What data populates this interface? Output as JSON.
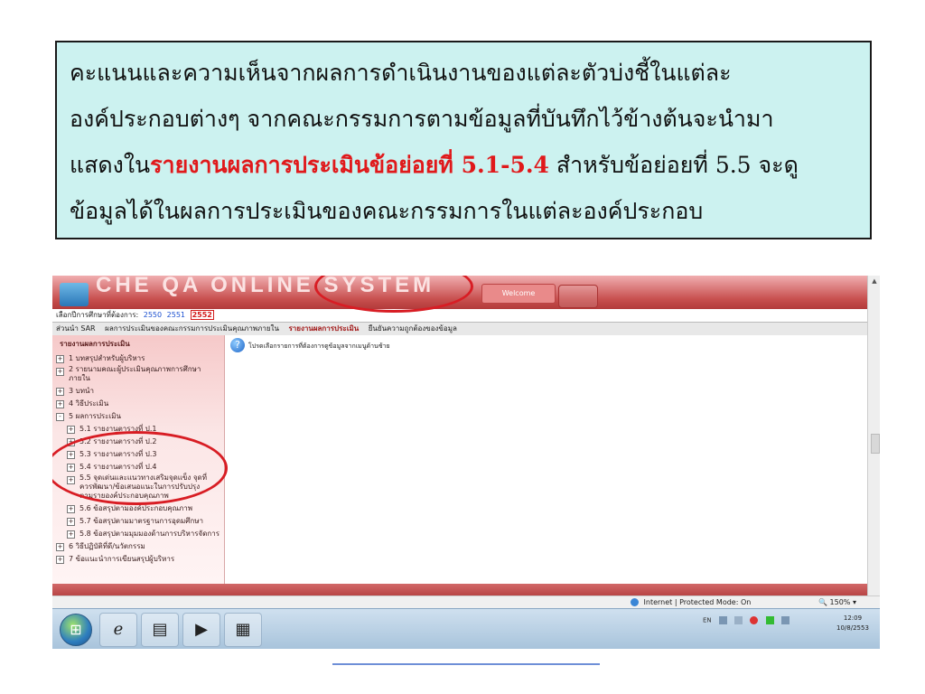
{
  "callout": {
    "line1": "คะแนนและความเห็นจากผลการดำเนินงานของแต่ละตัวบ่งชี้ในแต่ละ",
    "line2": "องค์ประกอบต่างๆ จากคณะกรรมการตามข้อมูลที่บันทึกไว้ข้างต้นจะนำมา",
    "line3_prefix": "แสดงใน",
    "line3_highlight": "รายงานผลการประเมินข้อย่อยที่ 5.1-5.4",
    "line3_suffix": " สำหรับข้อย่อยที่ 5.5 จะดู",
    "line4": "ข้อมูลได้ในผลการประเมินของคณะกรรมการในแต่ละองค์ประกอบ",
    "highlight_color": "#e0191b",
    "background_color": "#ccf2f0"
  },
  "app": {
    "title": "CHE QA ONLINE SYSTEM",
    "header_button": "Welcome",
    "year_selector": {
      "label": "เลือกปีการศึกษาที่ต้องการ:",
      "years": [
        "2550",
        "2551",
        "2552"
      ],
      "current": "2552"
    },
    "menu": [
      "ส่วนนำ SAR",
      "ผลการประเมินของคณะกรรมการประเมินคุณภาพภายใน",
      "รายงานผลการประเมิน",
      "ยืนยันความถูกต้องของข้อมูล"
    ],
    "sidebar": {
      "title": "รายงานผลการประเมิน",
      "items": [
        {
          "box": "+",
          "label": "1 บทสรุปสำหรับผู้บริหาร"
        },
        {
          "box": "+",
          "label": "2 รายนามคณะผู้ประเมินคุณภาพการศึกษาภายใน"
        },
        {
          "box": "+",
          "label": "3 บทนำ"
        },
        {
          "box": "+",
          "label": "4 วิธีประเมิน"
        },
        {
          "box": "-",
          "label": "5 ผลการประเมิน"
        },
        {
          "box": "+",
          "label": "5.1 รายงานตารางที่ ป.1"
        },
        {
          "box": "+",
          "label": "5.2 รายงานตารางที่ ป.2"
        },
        {
          "box": "+",
          "label": "5.3 รายงานตารางที่ ป.3"
        },
        {
          "box": "+",
          "label": "5.4 รายงานตารางที่ ป.4"
        },
        {
          "box": "+",
          "label": "5.5 จุดเด่นและแนวทางเสริมจุดแข็ง จุดที่ควรพัฒนา/ข้อเสนอแนะในการปรับปรุง ตามรายองค์ประกอบคุณภาพ"
        },
        {
          "box": "+",
          "label": "5.6 ข้อสรุปตามองค์ประกอบคุณภาพ"
        },
        {
          "box": "+",
          "label": "5.7 ข้อสรุปตามมาตรฐานการอุดมศึกษา"
        },
        {
          "box": "+",
          "label": "5.8 ข้อสรุปตามมุมมองด้านการบริหารจัดการ"
        },
        {
          "box": "+",
          "label": "6 วิธีปฏิบัติที่ดี/นวัตกรรม"
        },
        {
          "box": "+",
          "label": "7 ข้อแนะนำการเขียนสรุปผู้บริหาร"
        }
      ]
    },
    "content_message": "โปรดเลือกรายการที่ต้องการดูข้อมูลจากเมนูด้านซ้าย",
    "status": {
      "zone": "Internet | Protected Mode: On",
      "zoom": "150%"
    },
    "taskbar": {
      "language": "EN",
      "time": "12:09",
      "date": "10/8/2553"
    }
  }
}
